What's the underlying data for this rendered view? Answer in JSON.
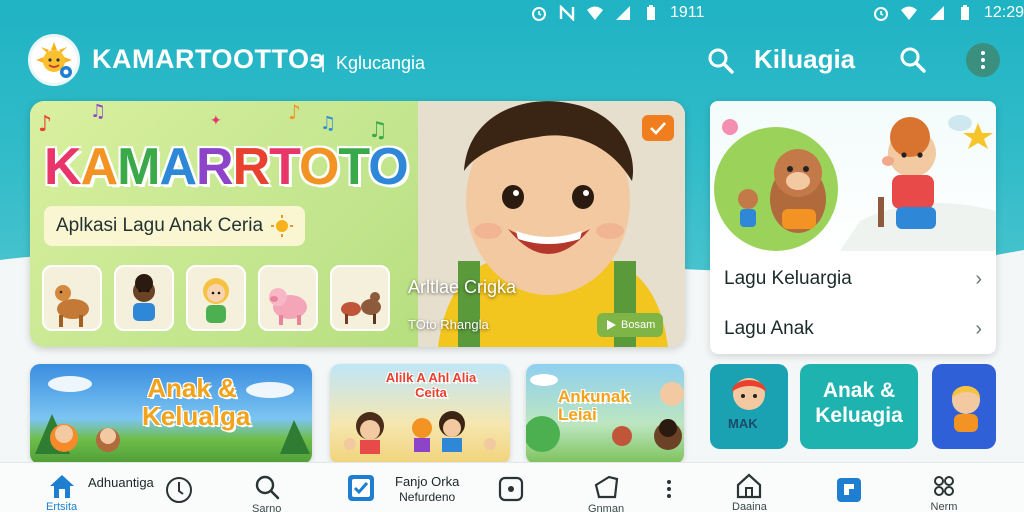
{
  "status_bar": {
    "left_time": "1911",
    "right_time": "12:29"
  },
  "app_bar": {
    "title": "KAMARTOOTTOɘ",
    "separator": "|",
    "subtitle": "Kglucangia",
    "right_title": "Kiluagia"
  },
  "hero": {
    "brand_letters": [
      "K",
      "A",
      "M",
      "A",
      "R",
      "R",
      "T",
      "O",
      "T",
      "O"
    ],
    "tagline": "Aplkasi Lagu Anak Ceria",
    "overlay_title": "Arltlae Crigka",
    "overlay_subtitle": "TOto Rhangla",
    "chip_label": "Bosam"
  },
  "side_card": {
    "rows": [
      {
        "label": "Lagu Keluargia"
      },
      {
        "label": "Lagu Anak"
      }
    ]
  },
  "categories": {
    "card1": "Anak & Kelualga",
    "card1_line1": "Anak &",
    "card1_line2": "Kelualga",
    "card2_line1": "Alilk A Ahl Alia",
    "card2_line2": "Ceita",
    "card3_line1": "Ankunak",
    "card3_line2": "Leiai",
    "tile1": "MAK",
    "tile2_line1": "Anak &",
    "tile2_line2": "Keluagia"
  },
  "bottom_nav": {
    "home_label": "Ertsita",
    "home_text": "Adhuantiga",
    "search_label": "Sarno",
    "middle_text_line1": "Fanjo Orka",
    "middle_text_line2": "Nefurdeno",
    "bag_label": "Gnman",
    "right1_label": "Daaina",
    "right3_label": "Nerm"
  },
  "colors": {
    "teal": "#1fb3c4",
    "brand_orange": "#f07d1e",
    "nav_active": "#1e7fd0"
  }
}
